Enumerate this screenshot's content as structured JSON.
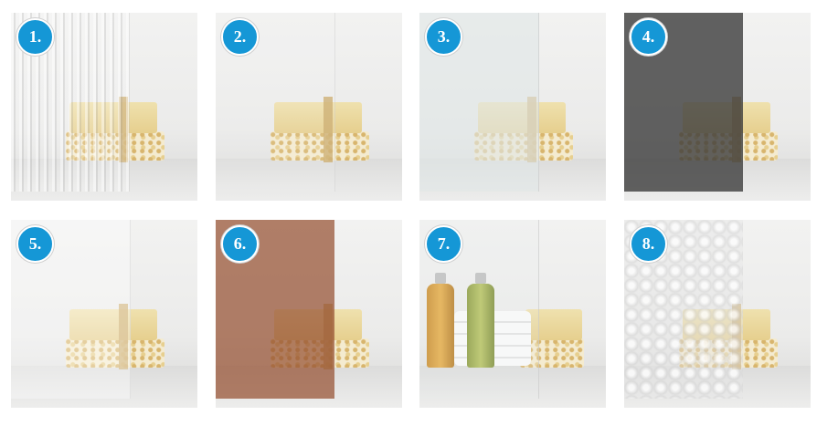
{
  "tiles": [
    {
      "label": "1.",
      "glass": "reeded"
    },
    {
      "label": "2.",
      "glass": "clear"
    },
    {
      "label": "3.",
      "glass": "frosted"
    },
    {
      "label": "4.",
      "glass": "grey"
    },
    {
      "label": "5.",
      "glass": "low-iron"
    },
    {
      "label": "6.",
      "glass": "bronze"
    },
    {
      "label": "7.",
      "glass": "clear"
    },
    {
      "label": "8.",
      "glass": "patterned"
    }
  ],
  "colors": {
    "badge": "#1597d6",
    "badge_text": "#ffffff"
  }
}
